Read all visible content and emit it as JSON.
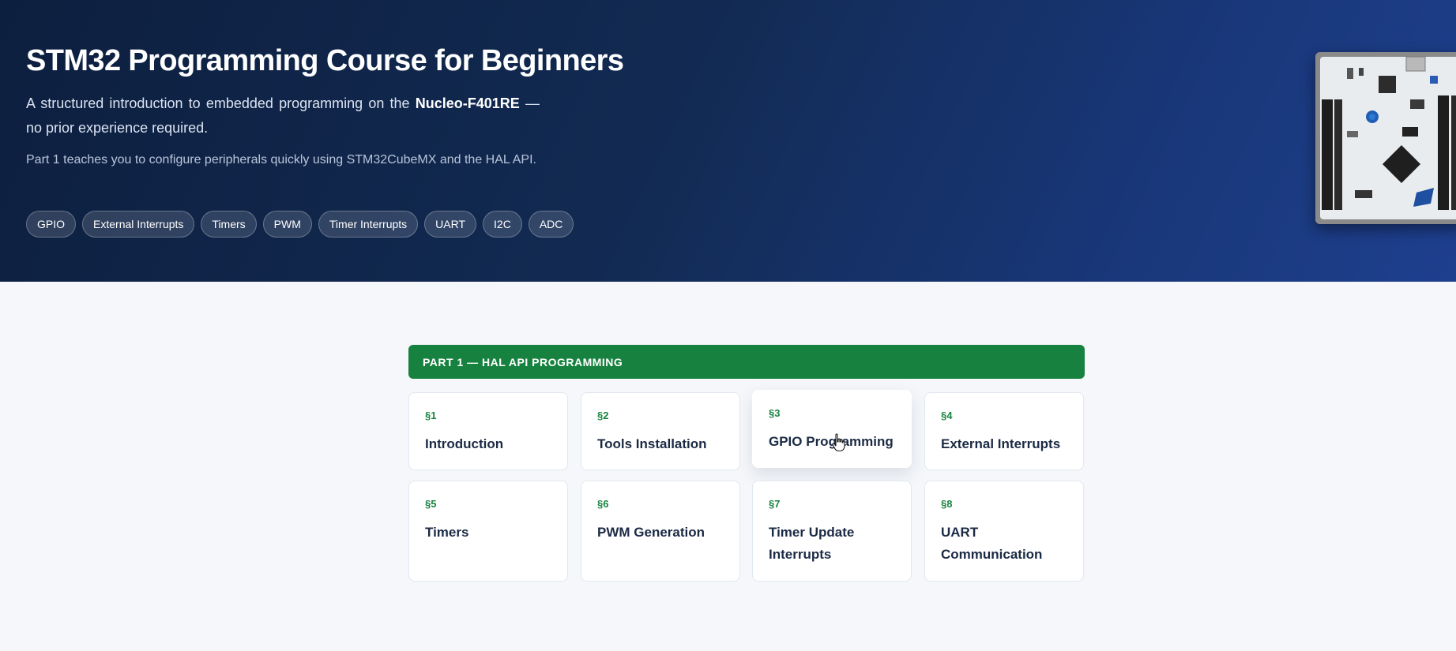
{
  "hero": {
    "title": "STM32 Programming Course for Beginners",
    "lead_prefix": "A structured introduction to embedded programming on the ",
    "lead_board": "Nucleo-F401RE",
    "lead_suffix": " — no prior experience required.",
    "sub": "Part 1 teaches you to configure peripherals quickly using STM32CubeMX and the HAL API.",
    "tags": [
      "GPIO",
      "External Interrupts",
      "Timers",
      "PWM",
      "Timer Interrupts",
      "UART",
      "I2C",
      "ADC"
    ],
    "image_alt": "Nucleo-F401RE board photo"
  },
  "part": {
    "header": "PART 1 — HAL API PROGRAMMING",
    "lessons": [
      {
        "num": "§1",
        "title": "Introduction"
      },
      {
        "num": "§2",
        "title": "Tools Installation"
      },
      {
        "num": "§3",
        "title": "GPIO Programming"
      },
      {
        "num": "§4",
        "title": "External Interrupts"
      },
      {
        "num": "§5",
        "title": "Timers"
      },
      {
        "num": "§6",
        "title": "PWM Generation"
      },
      {
        "num": "§7",
        "title": "Timer Update Interrupts"
      },
      {
        "num": "§8",
        "title": "UART Communication"
      }
    ]
  },
  "colors": {
    "hero_start": "#0d1f3f",
    "hero_end": "#1e3f8e",
    "accent_green": "#17823f",
    "page_bg": "#f5f7fa"
  }
}
